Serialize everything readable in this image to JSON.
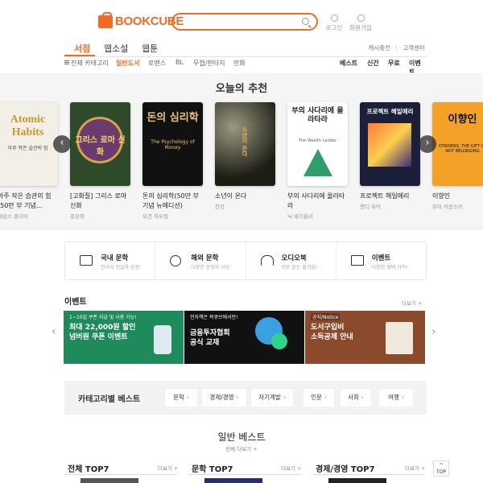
{
  "header": {
    "logo_text": "BOOKCUBE",
    "search_placeholder": "",
    "login_label": "로그인",
    "join_label": "회원가입"
  },
  "gnb": {
    "tabs": [
      "서점",
      "웹소설",
      "웹툰"
    ],
    "active_tab": "서점",
    "right_links": [
      "캐시충전",
      "고객센터"
    ]
  },
  "subnav": {
    "all_categories": "전체 카테고리",
    "items": [
      "일반도서",
      "로맨스",
      "BL",
      "무협/판타지",
      "만화"
    ],
    "active": "일반도서",
    "right_items": [
      "베스트",
      "신간",
      "무료",
      "이벤트"
    ]
  },
  "recommend": {
    "title": "오늘의 추천",
    "books": [
      {
        "title": "아주 작은 습관의 힘 (50만 부 기념...",
        "author": "제임스 클리어",
        "cover_text": "Atomic Habits",
        "cover_sub": "아주 작은 습관의 힘"
      },
      {
        "title": "[고화질] 그리스 로마 신화",
        "author": "홍은영",
        "cover_text": "그리스 로마 신화",
        "cover_sub": ""
      },
      {
        "title": "돈의 심리학(50만 부 기념 뉴에디션)",
        "author": "모건 하우절",
        "cover_text": "돈의 심리학",
        "cover_sub": "The Psychology of Money"
      },
      {
        "title": "소년이 온다",
        "author": "한강",
        "cover_text": "소년이 온다",
        "cover_sub": ""
      },
      {
        "title": "부의 사다리에 올라타라",
        "author": "닉 매기울리",
        "cover_text": "부의 사다리에 올라타라",
        "cover_sub": "The Wealth Ladder"
      },
      {
        "title": "프로젝트 헤일메리",
        "author": "앤디 위어",
        "cover_text": "프로젝트 헤일메리",
        "cover_sub": ""
      },
      {
        "title": "이향인",
        "author": "유아 커쉰스키",
        "cover_text": "이향인",
        "cover_sub": "OTRIVERS, THE GIFT OF NOT BELONGING"
      }
    ]
  },
  "quick_categories": [
    {
      "name": "국내 문학",
      "desc": "한국의 현실과 감정",
      "icon": "open-book-icon"
    },
    {
      "name": "해외 문학",
      "desc": "다양한 문화와 사상",
      "icon": "globe-icon"
    },
    {
      "name": "오디오북",
      "desc": "귀로 듣는 즐거움!",
      "icon": "headphones-icon"
    },
    {
      "name": "이벤트",
      "desc": "다양한 혜택 가득!",
      "icon": "gift-icon"
    }
  ],
  "events": {
    "title": "이벤트",
    "more": "더보기 +",
    "banners": [
      {
        "small": "1~10일 쿠폰 지급 및 사용 가능!",
        "text": "최대 22,000원 할인\n넘버원 쿠폰 이벤트",
        "bg": "#1f8a5b"
      },
      {
        "small": "전자책은 북큐브에서만!",
        "text": "금융투자협회\n공식 교재",
        "bg": "#111111"
      },
      {
        "small": "공지/Notice",
        "text": "도서구입비\n소득공제 안내",
        "bg": "#8a4a2b"
      }
    ]
  },
  "category_best": {
    "label": "카테고리별 베스트",
    "buttons": [
      "문학",
      "경제/경영",
      "자기계발",
      "인문",
      "사회",
      "여행"
    ]
  },
  "general_best": {
    "title": "일반 베스트",
    "more": "전체 더보기 +",
    "columns": [
      {
        "title": "전체 TOP7",
        "more": "더보기 +"
      },
      {
        "title": "문학 TOP7",
        "more": "더보기 +"
      },
      {
        "title": "경제/경영 TOP7",
        "more": "더보기 +"
      }
    ]
  },
  "top_button": "TOP",
  "colors": {
    "accent": "#f26b24"
  }
}
